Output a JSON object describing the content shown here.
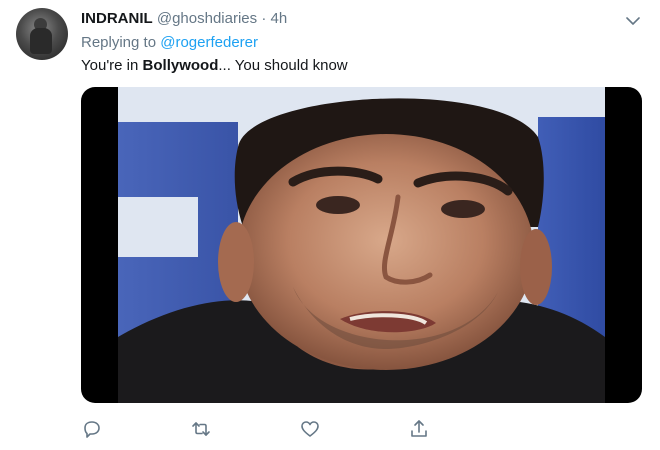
{
  "tweet": {
    "author_name": "INDRANIL",
    "author_handle": "@ghoshdiaries",
    "separator": "·",
    "time": "4h",
    "replying_prefix": "Replying to",
    "replying_to": "@rogerfederer",
    "text_before": "You're in ",
    "text_bold": "Bollywood",
    "text_after": "... You should know"
  },
  "actions": [
    "reply-icon",
    "retweet-icon",
    "like-icon",
    "share-icon"
  ],
  "colors": {
    "link": "#1da1f2",
    "muted": "#657786",
    "text": "#14171a"
  }
}
